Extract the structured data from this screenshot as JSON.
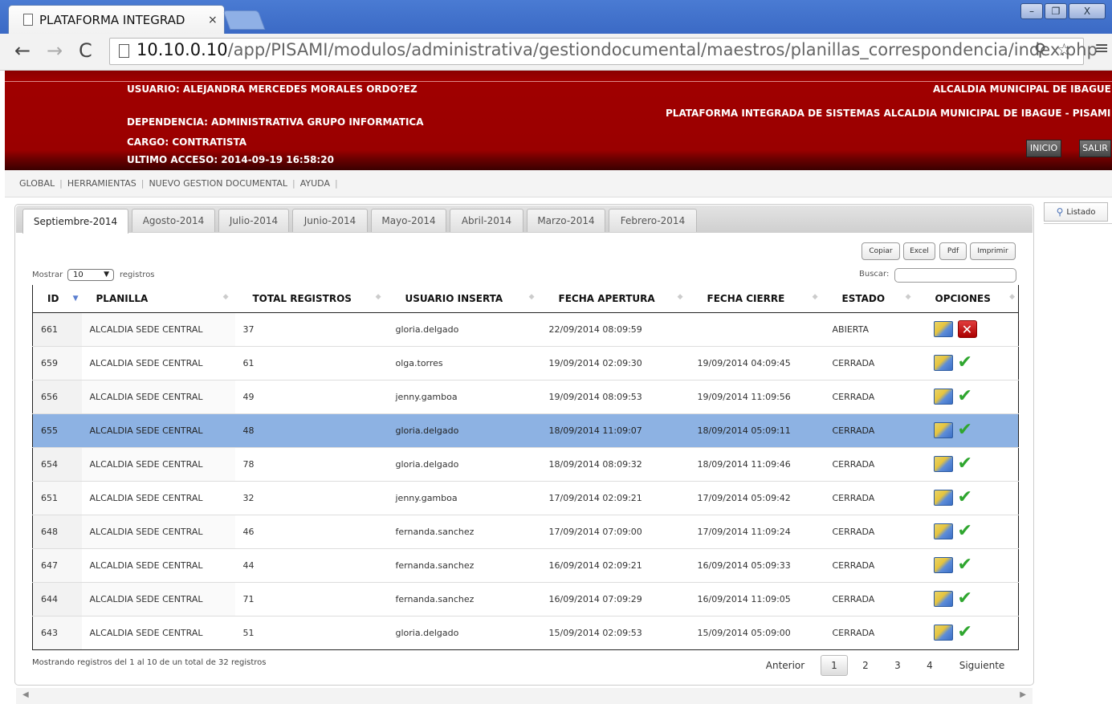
{
  "browser": {
    "tab_title": "PLATAFORMA INTEGRAD",
    "tab_close": "×",
    "url_host": "10.10.0.10",
    "url_path": "/app/PISAMI/modulos/administrativa/gestiondocumental/maestros/planillas_correspondencia/index.php",
    "win_min": "–",
    "win_max": "❐",
    "win_close": "X"
  },
  "header": {
    "usuario": "USUARIO: ALEJANDRA MERCEDES MORALES ORDO?EZ",
    "dependencia": "DEPENDENCIA: ADMINISTRATIVA GRUPO INFORMATICA",
    "cargo": "CARGO: CONTRATISTA",
    "ultimo_acceso": "ULTIMO ACCESO: 2014-09-19 16:58:20",
    "alcaldia": "ALCALDIA MUNICIPAL DE IBAGUE",
    "plataforma": "PLATAFORMA INTEGRADA DE SISTEMAS ALCALDIA MUNICIPAL DE IBAGUE - PISAMI",
    "inicio": "INICIO",
    "salir": "SALIR"
  },
  "menu": {
    "items": [
      "GLOBAL",
      "HERRAMIENTAS",
      "NUEVO GESTION DOCUMENTAL",
      "AYUDA"
    ]
  },
  "listado_label": "Listado",
  "tabs": [
    "Septiembre-2014",
    "Agosto-2014",
    "Julio-2014",
    "Junio-2014",
    "Mayo-2014",
    "Abril-2014",
    "Marzo-2014",
    "Febrero-2014"
  ],
  "export": {
    "copiar": "Copiar",
    "excel": "Excel",
    "pdf": "Pdf",
    "imprimir": "Imprimir"
  },
  "controls": {
    "mostrar": "Mostrar",
    "length": "10",
    "registros": "registros",
    "buscar": "Buscar:"
  },
  "table": {
    "headers": [
      "ID",
      "PLANILLA",
      "TOTAL REGISTROS",
      "USUARIO INSERTA",
      "FECHA APERTURA",
      "FECHA CIERRE",
      "ESTADO",
      "OPCIONES"
    ],
    "rows": [
      {
        "id": "661",
        "planilla": "ALCALDIA SEDE CENTRAL",
        "total": "37",
        "usuario": "gloria.delgado",
        "apertura": "22/09/2014 08:09:59",
        "cierre": "",
        "estado": "ABIERTA"
      },
      {
        "id": "659",
        "planilla": "ALCALDIA SEDE CENTRAL",
        "total": "61",
        "usuario": "olga.torres",
        "apertura": "19/09/2014 02:09:30",
        "cierre": "19/09/2014 04:09:45",
        "estado": "CERRADA"
      },
      {
        "id": "656",
        "planilla": "ALCALDIA SEDE CENTRAL",
        "total": "49",
        "usuario": "jenny.gamboa",
        "apertura": "19/09/2014 08:09:53",
        "cierre": "19/09/2014 11:09:56",
        "estado": "CERRADA"
      },
      {
        "id": "655",
        "planilla": "ALCALDIA SEDE CENTRAL",
        "total": "48",
        "usuario": "gloria.delgado",
        "apertura": "18/09/2014 11:09:07",
        "cierre": "18/09/2014 05:09:11",
        "estado": "CERRADA"
      },
      {
        "id": "654",
        "planilla": "ALCALDIA SEDE CENTRAL",
        "total": "78",
        "usuario": "gloria.delgado",
        "apertura": "18/09/2014 08:09:32",
        "cierre": "18/09/2014 11:09:46",
        "estado": "CERRADA"
      },
      {
        "id": "651",
        "planilla": "ALCALDIA SEDE CENTRAL",
        "total": "32",
        "usuario": "jenny.gamboa",
        "apertura": "17/09/2014 02:09:21",
        "cierre": "17/09/2014 05:09:42",
        "estado": "CERRADA"
      },
      {
        "id": "648",
        "planilla": "ALCALDIA SEDE CENTRAL",
        "total": "46",
        "usuario": "fernanda.sanchez",
        "apertura": "17/09/2014 07:09:00",
        "cierre": "17/09/2014 11:09:24",
        "estado": "CERRADA"
      },
      {
        "id": "647",
        "planilla": "ALCALDIA SEDE CENTRAL",
        "total": "44",
        "usuario": "fernanda.sanchez",
        "apertura": "16/09/2014 02:09:21",
        "cierre": "16/09/2014 05:09:33",
        "estado": "CERRADA"
      },
      {
        "id": "644",
        "planilla": "ALCALDIA SEDE CENTRAL",
        "total": "71",
        "usuario": "fernanda.sanchez",
        "apertura": "16/09/2014 07:09:29",
        "cierre": "16/09/2014 11:09:05",
        "estado": "CERRADA"
      },
      {
        "id": "643",
        "planilla": "ALCALDIA SEDE CENTRAL",
        "total": "51",
        "usuario": "gloria.delgado",
        "apertura": "15/09/2014 02:09:53",
        "cierre": "15/09/2014 05:09:00",
        "estado": "CERRADA"
      }
    ]
  },
  "footer": {
    "info": "Mostrando registros del 1 al 10 de un total de 32 registros",
    "anterior": "Anterior",
    "pages": [
      "1",
      "2",
      "3",
      "4"
    ],
    "siguiente": "Siguiente"
  },
  "icons": {
    "open_close": "x-icon",
    "closed": "check-icon",
    "view": "document-icon"
  },
  "colors": {
    "header_red": "#9a0000",
    "selected_row": "#8db2e3",
    "chrome_blue": "#4a7bd3"
  }
}
